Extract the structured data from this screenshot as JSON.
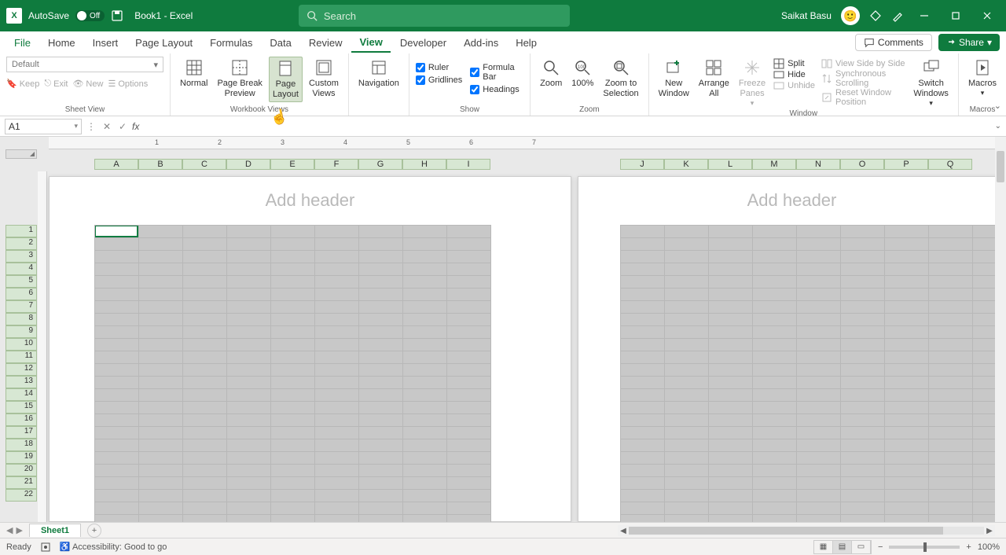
{
  "titlebar": {
    "autosave_label": "AutoSave",
    "autosave_state": "Off",
    "doc_title": "Book1 - Excel",
    "search_placeholder": "Search",
    "user_name": "Saikat Basu"
  },
  "menu": {
    "tabs": [
      "File",
      "Home",
      "Insert",
      "Page Layout",
      "Formulas",
      "Data",
      "Review",
      "View",
      "Developer",
      "Add-ins",
      "Help"
    ],
    "active": "View",
    "comments": "Comments",
    "share": "Share"
  },
  "ribbon": {
    "sheet_view": {
      "label": "Sheet View",
      "selector": "Default",
      "keep": "Keep",
      "exit": "Exit",
      "new": "New",
      "options": "Options"
    },
    "workbook_views": {
      "label": "Workbook Views",
      "normal": "Normal",
      "page_break": "Page Break\nPreview",
      "page_layout": "Page\nLayout",
      "custom_views": "Custom\nViews"
    },
    "navigation": {
      "label": "Navigation"
    },
    "show": {
      "label": "Show",
      "ruler": "Ruler",
      "formula_bar": "Formula Bar",
      "gridlines": "Gridlines",
      "headings": "Headings"
    },
    "zoom": {
      "label": "Zoom",
      "zoom": "Zoom",
      "hundred": "100%",
      "to_selection": "Zoom to\nSelection"
    },
    "window": {
      "label": "Window",
      "new_window": "New\nWindow",
      "arrange_all": "Arrange\nAll",
      "freeze_panes": "Freeze\nPanes",
      "split": "Split",
      "hide": "Hide",
      "unhide": "Unhide",
      "side_by_side": "View Side by Side",
      "sync_scroll": "Synchronous Scrolling",
      "reset_pos": "Reset Window Position",
      "switch_windows": "Switch\nWindows"
    },
    "macros": {
      "label": "Macros",
      "btn": "Macros"
    }
  },
  "formulabar": {
    "cell_ref": "A1"
  },
  "sheet": {
    "columns_p1": [
      "A",
      "B",
      "C",
      "D",
      "E",
      "F",
      "G",
      "H",
      "I"
    ],
    "columns_p2": [
      "J",
      "K",
      "L",
      "M",
      "N",
      "O",
      "P",
      "Q"
    ],
    "rows": [
      "1",
      "2",
      "3",
      "4",
      "5",
      "6",
      "7",
      "8",
      "9",
      "10",
      "11",
      "12",
      "13",
      "14",
      "15",
      "16",
      "17",
      "18",
      "19",
      "20",
      "21",
      "22"
    ],
    "add_header": "Add header",
    "ruler_marks": [
      "1",
      "2",
      "3",
      "4",
      "5",
      "6",
      "7"
    ],
    "tab_name": "Sheet1"
  },
  "statusbar": {
    "ready": "Ready",
    "accessibility": "Accessibility: Good to go",
    "zoom": "100%"
  }
}
